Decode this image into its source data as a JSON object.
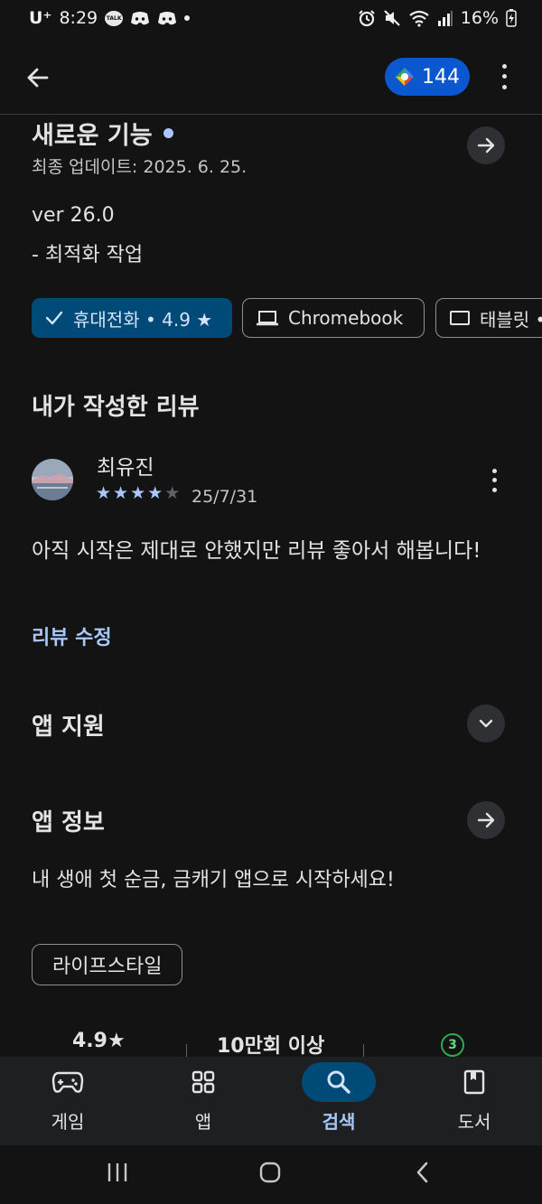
{
  "status_bar": {
    "carrier": "U⁺",
    "time": "8:29",
    "talk_label": "TALK",
    "battery": "16%"
  },
  "app_bar": {
    "points": "144"
  },
  "whats_new": {
    "title": "새로운 기능",
    "updated": "최종 업데이트: 2025. 6. 25.",
    "version": "ver 26.0",
    "note": "- 최적화 작업"
  },
  "device_chips": [
    {
      "label": "휴대전화 • 4.9 ★",
      "selected": true
    },
    {
      "label": "Chromebook",
      "selected": false
    },
    {
      "label": "태블릿 •",
      "selected": false
    }
  ],
  "my_review": {
    "section_title": "내가 작성한 리뷰",
    "author": "최유진",
    "rating": 4,
    "max_rating": 5,
    "date": "25/7/31",
    "text": "아직 시작은 제대로 안했지만 리뷰 좋아서 해봅니다!",
    "edit_label": "리뷰 수정"
  },
  "app_support": {
    "title": "앱 지원"
  },
  "app_info": {
    "title": "앱 정보",
    "tagline": "내 생애 첫 순금, 금캐기 앱으로 시작하세요!",
    "category": "라이프스타일"
  },
  "stats": {
    "rating": "4.9★",
    "downloads": "10만회 이상",
    "age_rating": "3"
  },
  "bottom_nav": [
    {
      "label": "게임",
      "icon": "gamepad-icon",
      "active": false
    },
    {
      "label": "앱",
      "icon": "apps-grid-icon",
      "active": false
    },
    {
      "label": "검색",
      "icon": "search-icon",
      "active": true
    },
    {
      "label": "도서",
      "icon": "book-icon",
      "active": false
    }
  ],
  "colors": {
    "background": "#131314",
    "accent": "#a8c7fa",
    "selected_chip": "#004a77",
    "points_badge": "#0b57d0"
  }
}
